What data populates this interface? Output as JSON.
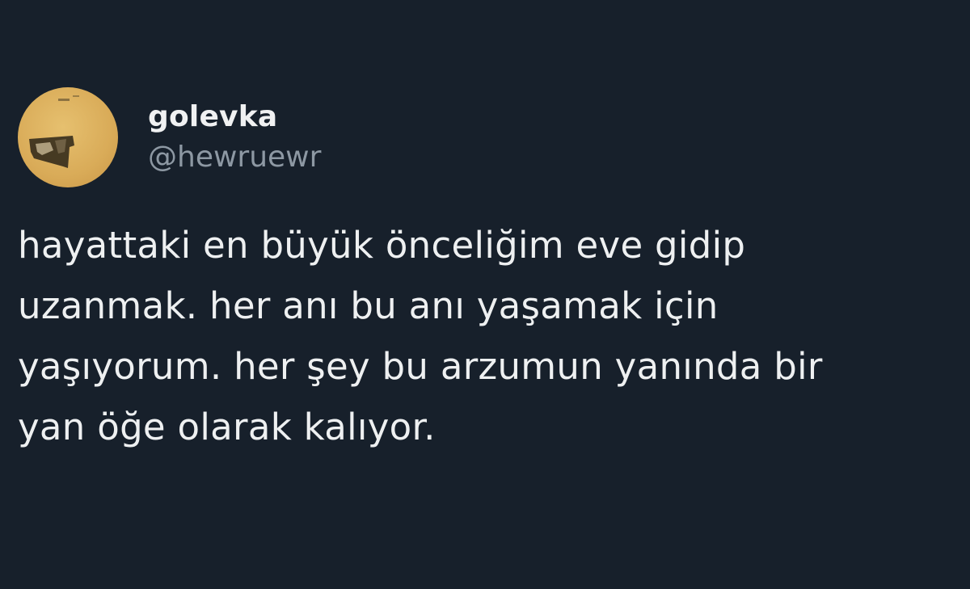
{
  "tweet": {
    "author": {
      "display_name": "golevka",
      "handle": "@hewruewr",
      "avatar_icon": "avatar-image"
    },
    "text": "hayattaki en büyük önceliğim eve gidip\nuzanmak. her anı bu anı yaşamak için\nyaşıyorum. her şey bu arzumun yanında bir\nyan öğe olarak kalıyor."
  },
  "colors": {
    "background": "#17202b",
    "text": "#eef0f1",
    "handle": "#8d98a3",
    "avatar": "#dcae5b"
  }
}
